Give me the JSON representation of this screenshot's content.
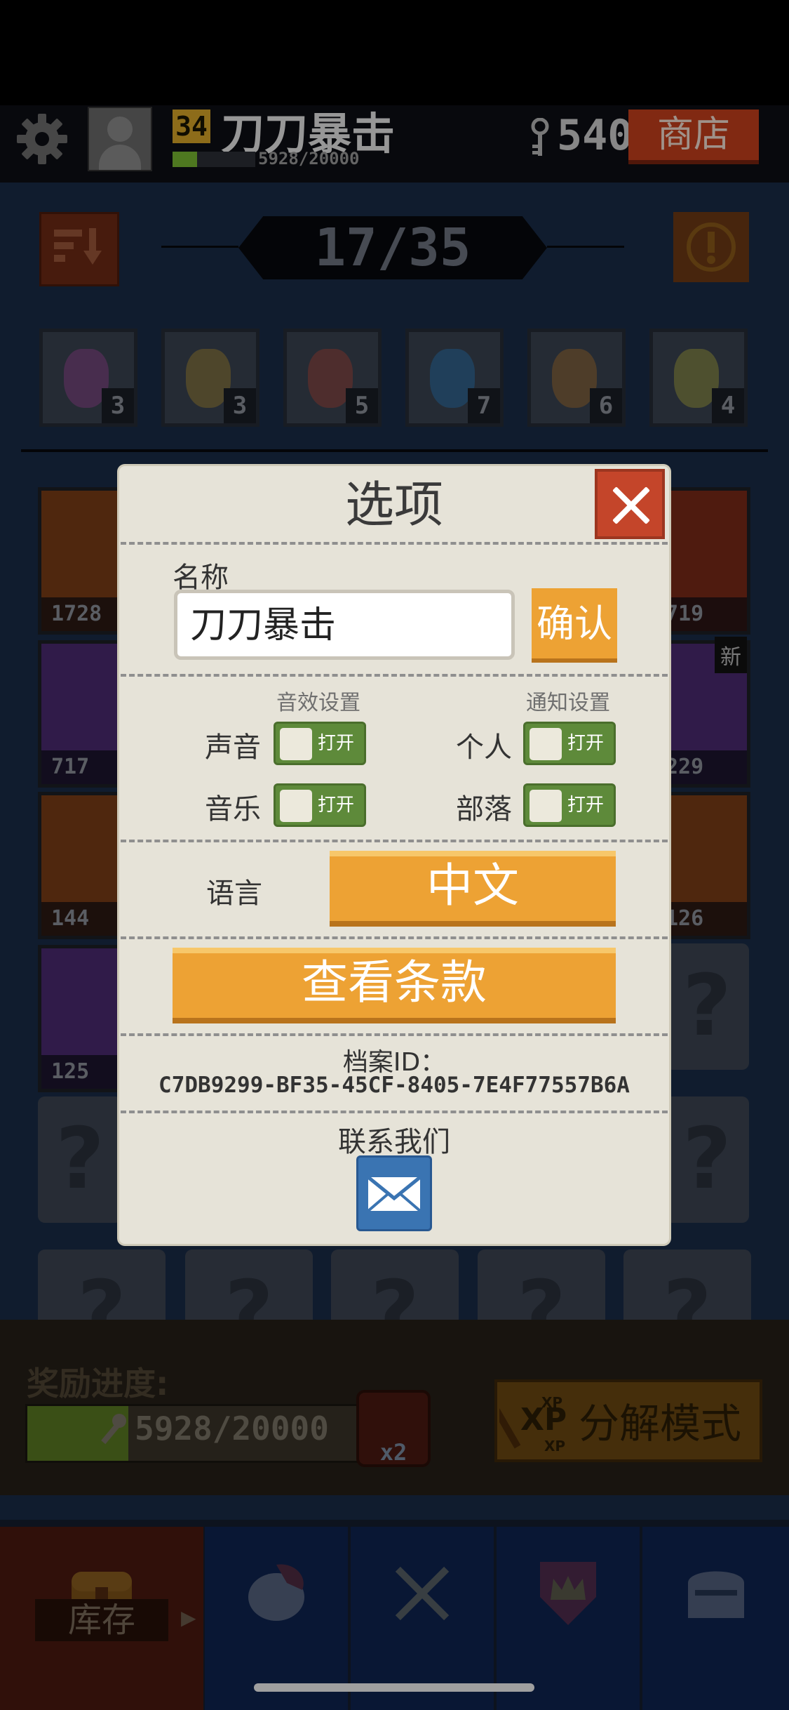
{
  "header": {
    "level": "34",
    "player_name": "刀刀暴击",
    "xp_text": "5928/20000",
    "xp_progress": 0.3,
    "coins": "540",
    "shop_label": "商店"
  },
  "collection": {
    "page_indicator": "17/35",
    "potions": [
      {
        "count": "3",
        "color": "#b24aa8"
      },
      {
        "count": "3",
        "color": "#c8a030"
      },
      {
        "count": "5",
        "color": "#c84a3a"
      },
      {
        "count": "7",
        "color": "#2a8ad0"
      },
      {
        "count": "6",
        "color": "#c8802a"
      },
      {
        "count": "4",
        "color": "#c8c040"
      }
    ],
    "left_cards": [
      {
        "value": "1728",
        "bg": "#7a3d16"
      },
      {
        "value": "717",
        "bg": "#4a2a70"
      },
      {
        "value": "144",
        "bg": "#7a3d16"
      },
      {
        "value": "125",
        "bg": "#4a2a70"
      }
    ],
    "right_cards": [
      {
        "value": "719",
        "bg": "#7a2a18"
      },
      {
        "value": "229",
        "bg": "#4a2a70",
        "badge": "新"
      },
      {
        "value": "126",
        "bg": "#7a3d16"
      }
    ],
    "empty_glyph": "?"
  },
  "modal": {
    "title": "选项",
    "name_label": "名称",
    "name_value": "刀刀暴击",
    "confirm_label": "确认",
    "sound_settings_label": "音效设置",
    "notification_settings_label": "通知设置",
    "sound_label": "声音",
    "music_label": "音乐",
    "personal_label": "个人",
    "tribe_label": "部落",
    "toggle_on_label": "打开",
    "language_label": "语言",
    "language_value": "中文",
    "terms_label": "查看条款",
    "profile_id_label": "档案ID：",
    "profile_id_value": "C7DB9299-BF35-45CF-8405-7E4F77557B6A",
    "contact_label": "联系我们"
  },
  "rewards": {
    "title": "奖励进度:",
    "progress_text": "5928/20000",
    "progress": 0.3,
    "multiplier": "x2",
    "dismantle_label": "分解模式"
  },
  "tabs": {
    "inventory_label": "库存"
  },
  "colors": {
    "accent_orange": "#eda234",
    "close_red": "#c4452a",
    "toggle_green": "#5e8a3a",
    "modal_bg": "#e6e3d8"
  },
  "icons": [
    "gear-icon",
    "avatar-icon",
    "key-icon",
    "sort-icon",
    "alert-icon",
    "close-icon",
    "mail-icon",
    "wrench-icon",
    "chest-icon",
    "helmet-icon",
    "swords-icon",
    "crown-shield-icon",
    "knight-helmet-icon"
  ]
}
